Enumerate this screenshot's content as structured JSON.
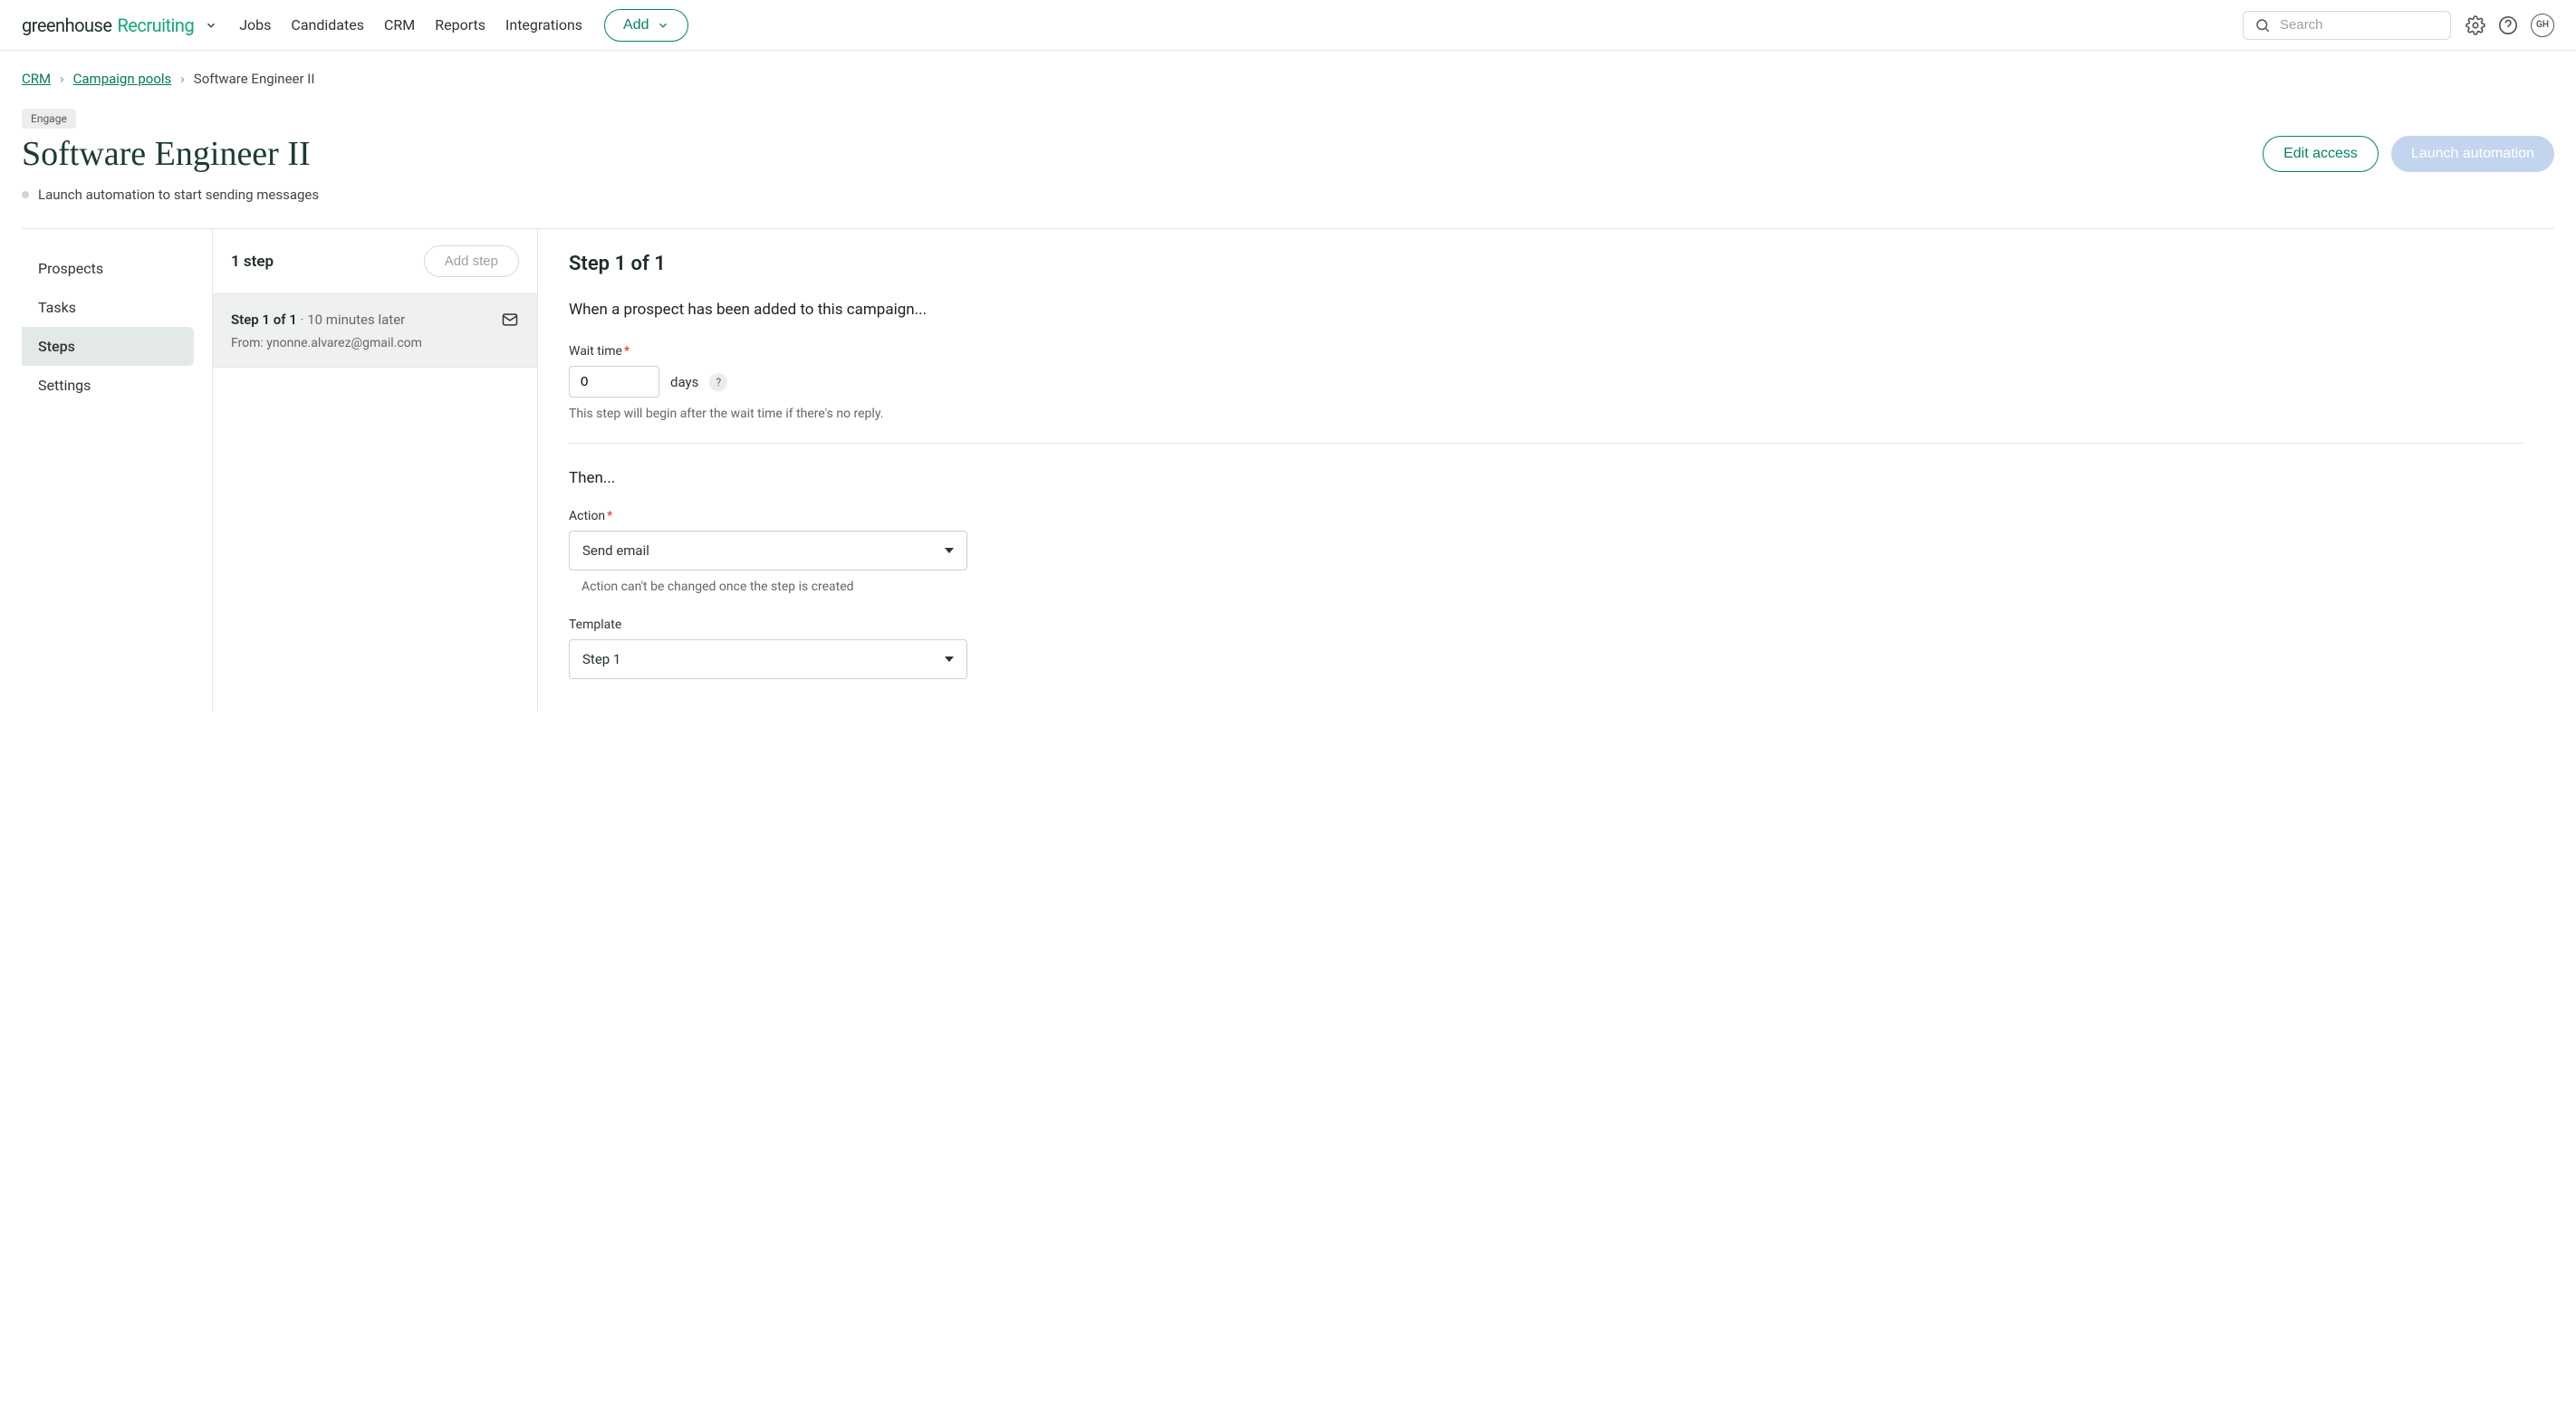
{
  "nav": {
    "logo_word1": "greenhouse",
    "logo_word2": "Recruiting",
    "items": [
      "Jobs",
      "Candidates",
      "CRM",
      "Reports",
      "Integrations"
    ],
    "add_label": "Add",
    "search_placeholder": "Search",
    "avatar_initials": "GH"
  },
  "breadcrumb": {
    "links": [
      "CRM",
      "Campaign pools"
    ],
    "current": "Software Engineer II"
  },
  "header": {
    "badge": "Engage",
    "title": "Software Engineer II",
    "edit_access_label": "Edit access",
    "launch_label": "Launch automation",
    "status_text": "Launch automation to start sending messages"
  },
  "sidenav": {
    "items": [
      "Prospects",
      "Tasks",
      "Steps",
      "Settings"
    ],
    "active_index": 2
  },
  "steplist": {
    "header": "1 step",
    "add_step_label": "Add step",
    "cards": [
      {
        "title_strong": "Step 1 of 1",
        "title_muted": " · 10 minutes later",
        "from_label": "From: ynonne.alvarez@gmail.com"
      }
    ]
  },
  "detail": {
    "heading": "Step 1 of 1",
    "intro": "When a prospect has been added to this campaign...",
    "wait_label": "Wait time",
    "wait_value": "0",
    "days_label": "days",
    "wait_help": "This step will begin after the wait time if there's no reply.",
    "then_label": "Then...",
    "action_label": "Action",
    "action_value": "Send email",
    "action_help": "Action can't be changed once the step is created",
    "template_label": "Template",
    "template_value": "Step 1"
  }
}
